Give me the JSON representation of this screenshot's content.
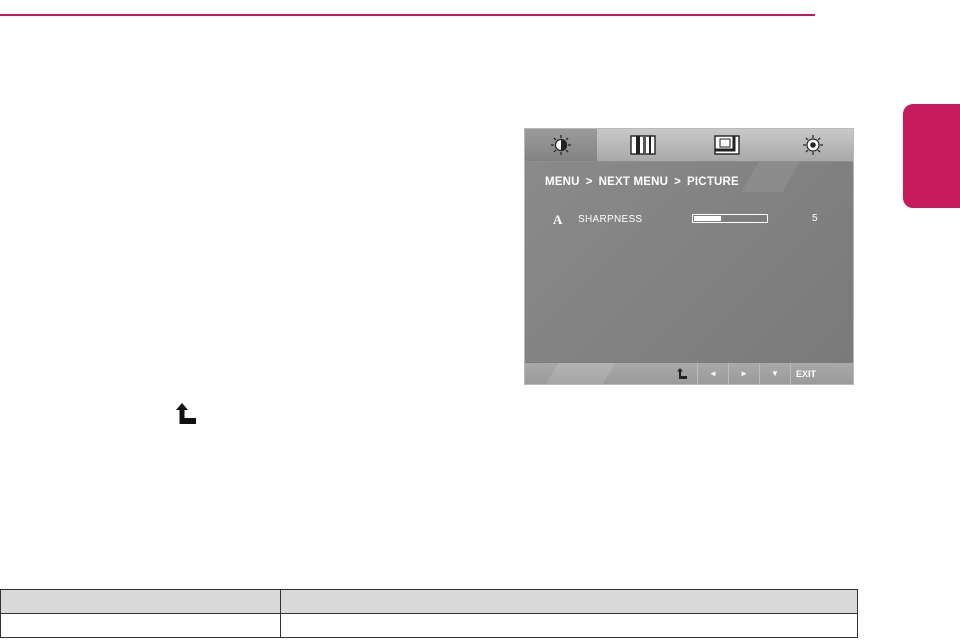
{
  "osd": {
    "tabs": [
      {
        "icon": "brightness-icon",
        "active": true
      },
      {
        "icon": "color-bars-icon",
        "active": false
      },
      {
        "icon": "display-position-icon",
        "active": false
      },
      {
        "icon": "settings-gear-icon",
        "active": false
      }
    ],
    "breadcrumb": [
      "MENU",
      "NEXT MENU",
      "PICTURE"
    ],
    "breadcrumb_separator": ">",
    "setting": {
      "icon_glyph": "A",
      "label": "SHARPNESS",
      "value": "5",
      "fill_fraction": 0.38
    },
    "bottom_keys": {
      "left": "◄",
      "right": "►",
      "down": "▼",
      "exit": "EXIT"
    }
  },
  "colors": {
    "accent": "#c2185b",
    "osd_background": "#7d7d7d",
    "osd_tabbar": "#b8b8b8"
  },
  "table": {
    "rows": [
      [
        "",
        ""
      ],
      [
        "",
        ""
      ]
    ]
  }
}
